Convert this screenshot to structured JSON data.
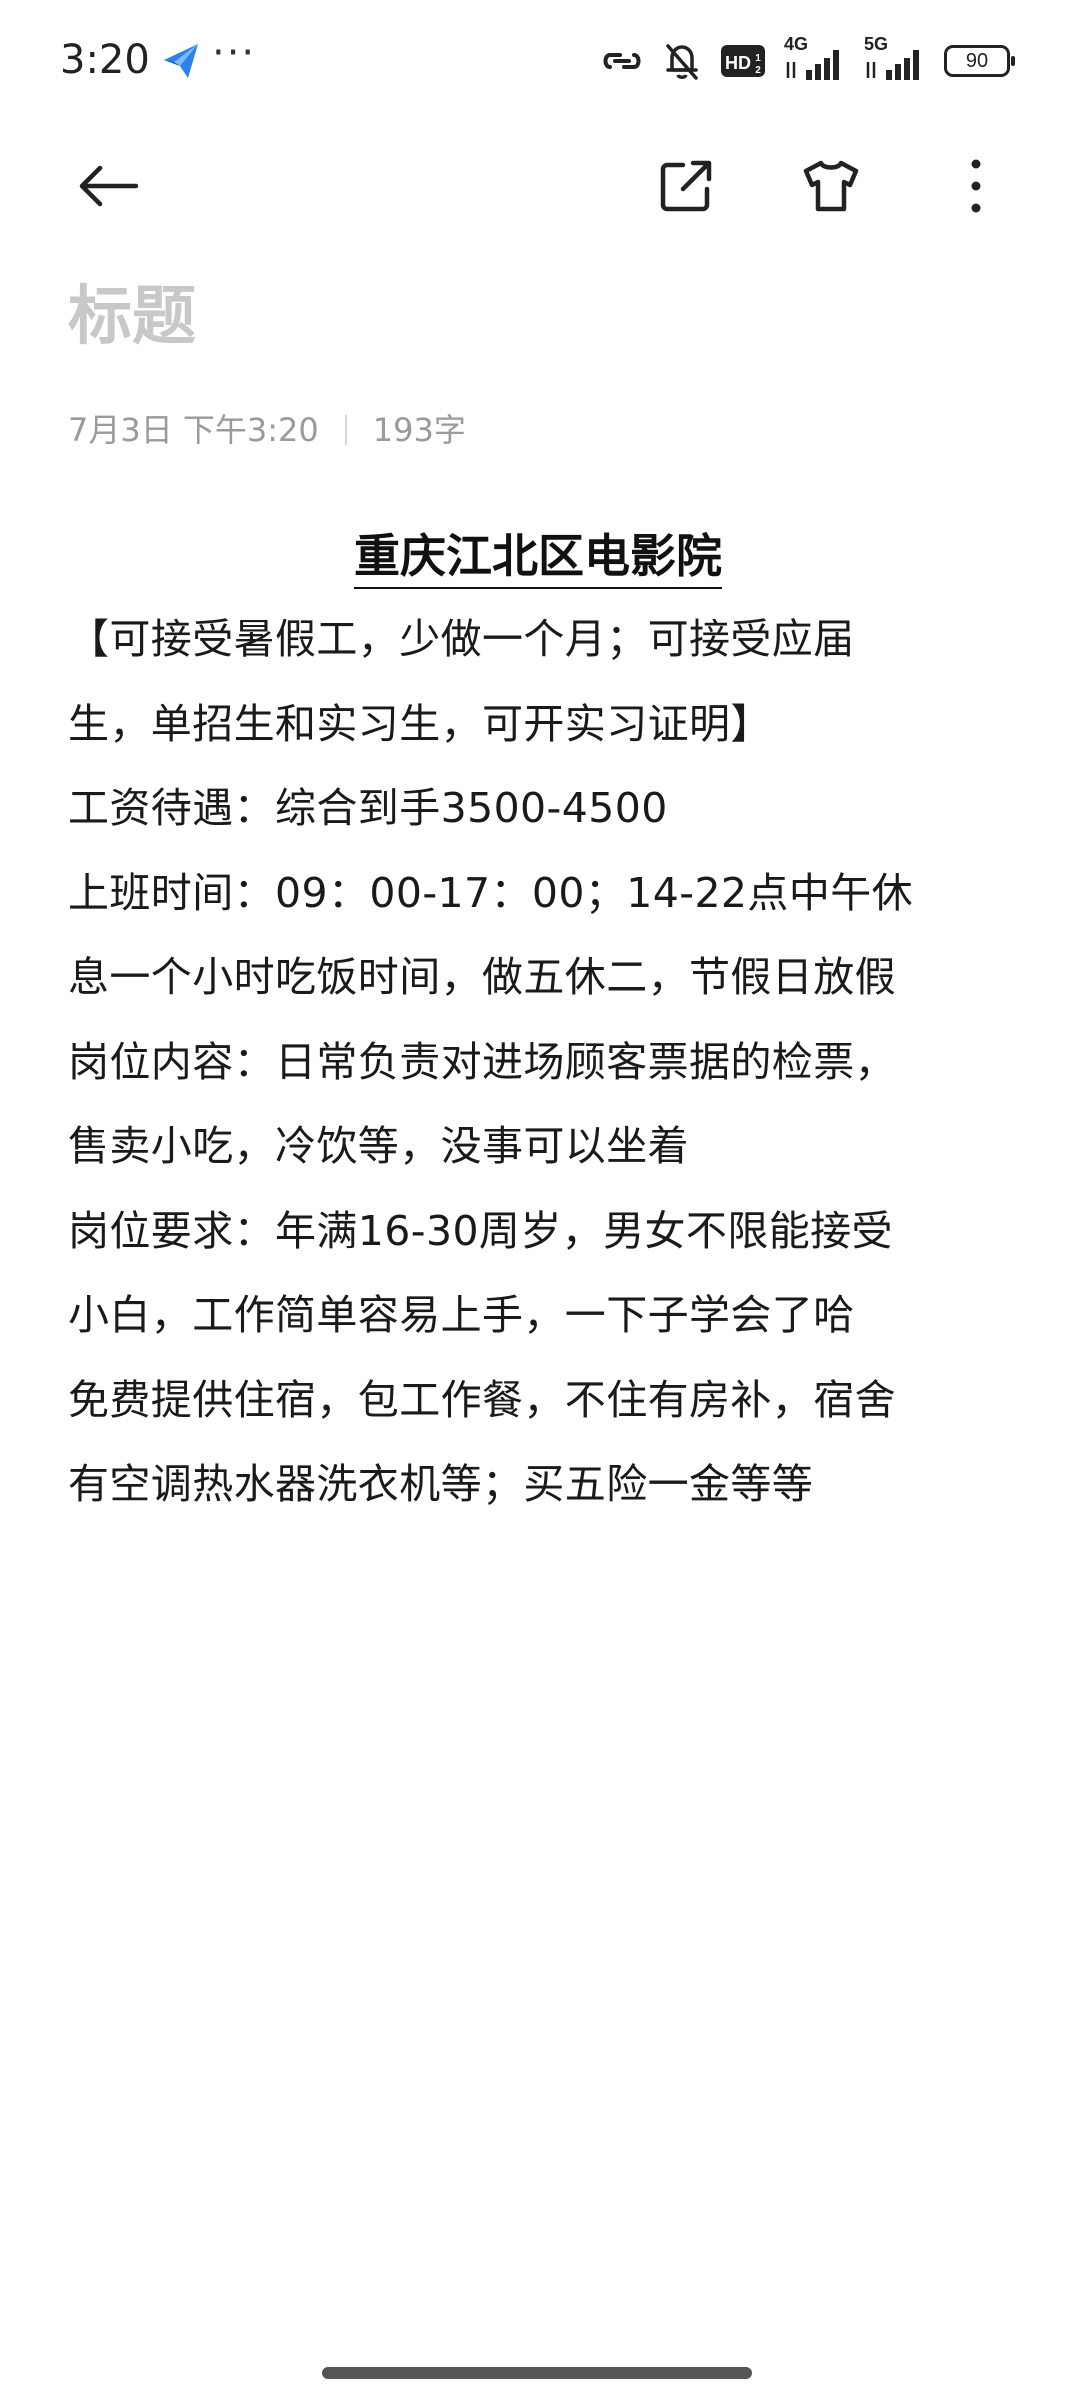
{
  "status_bar": {
    "time": "3:20",
    "more": "···",
    "hd_label": "HD",
    "net1": "4G",
    "net2": "5G",
    "battery": "90"
  },
  "note": {
    "title_placeholder": "标题",
    "date": "7月3日 下午3:20",
    "char_count": "193字",
    "heading": "重庆江北区电影院",
    "lines": [
      "【可接受暑假工，少做一个月；可接受应届",
      "生，单招生和实习生，可开实习证明】",
      "工资待遇：综合到手3500-4500",
      "上班时间：09：00-17：00；14-22点中午休",
      "息一个小时吃饭时间，做五休二，节假日放假",
      "岗位内容：日常负责对进场顾客票据的检票，",
      "售卖小吃，冷饮等，没事可以坐着",
      "岗位要求：年满16-30周岁，男女不限能接受",
      "小白，工作简单容易上手，一下子学会了哈",
      "免费提供住宿，包工作餐，不住有房补，宿舍",
      "有空调热水器洗衣机等；买五险一金等等"
    ]
  },
  "icons": {
    "back": "arrow-left-icon",
    "share": "share-external-icon",
    "theme": "tshirt-icon",
    "more": "more-vertical-icon"
  }
}
